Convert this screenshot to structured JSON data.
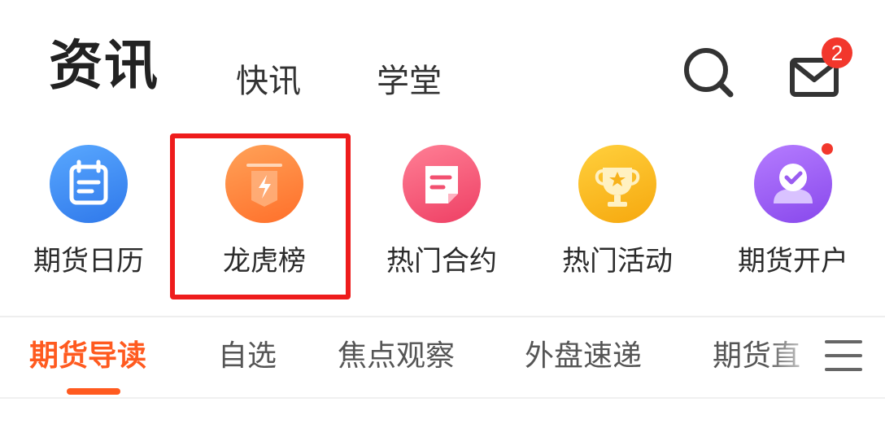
{
  "header": {
    "title": "资讯",
    "tabs": [
      {
        "label": "快讯"
      },
      {
        "label": "学堂"
      }
    ],
    "mail_badge_count": "2"
  },
  "quick_entries": [
    {
      "label": "期货日历",
      "icon": "calendar-icon",
      "color": "#3d8cf0"
    },
    {
      "label": "龙虎榜",
      "icon": "lightning-tag-icon",
      "color": "#ff7a30",
      "highlighted": true
    },
    {
      "label": "热门合约",
      "icon": "contract-icon",
      "color": "#f25070"
    },
    {
      "label": "热门活动",
      "icon": "trophy-icon",
      "color": "#f7b21a"
    },
    {
      "label": "期货开户",
      "icon": "account-check-icon",
      "color": "#9a5cf0",
      "has_new_dot": true
    }
  ],
  "category_tabs": [
    {
      "label": "期货导读",
      "active": true
    },
    {
      "label": "自选"
    },
    {
      "label": "焦点观察"
    },
    {
      "label": "外盘速递"
    },
    {
      "label": "期货直"
    }
  ],
  "colors": {
    "accent": "#ff5a1f",
    "badge": "#f2372c",
    "highlight_border": "#ee1c1c"
  }
}
